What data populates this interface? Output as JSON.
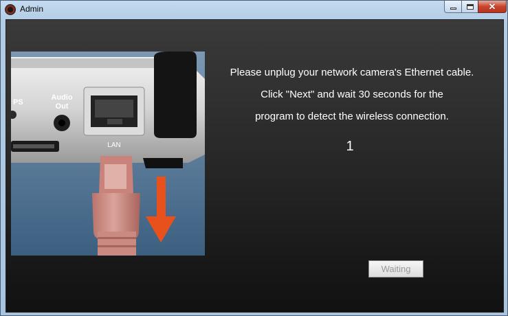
{
  "window": {
    "title": "Admin"
  },
  "controls": {
    "minimize": "minimize-icon",
    "maximize": "maximize-icon",
    "close": "close-icon"
  },
  "photo": {
    "ports": {
      "left_label": "PS",
      "audio": "Audio",
      "audio2": "Out",
      "lan": "LAN"
    }
  },
  "message": {
    "line1": "Please unplug your network camera's Ethernet cable.",
    "line2": "Click \"Next\" and wait 30 seconds for the",
    "line3": "program to detect the wireless connection."
  },
  "counter": "1",
  "button": {
    "label": "Waiting"
  },
  "colors": {
    "arrow": "#e8511c",
    "cable": "#c98a82",
    "background": "#2b2b2b"
  }
}
